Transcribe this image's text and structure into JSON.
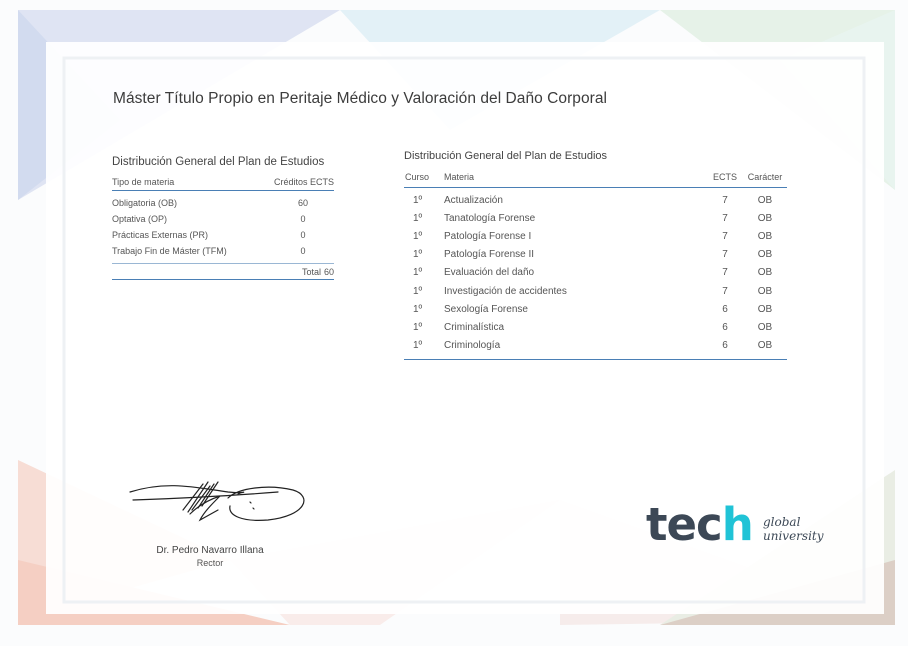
{
  "document": {
    "title": "Máster Título Propio en Peritaje Médico y Valoración del Daño Corporal"
  },
  "summary": {
    "heading": "Distribución General del Plan de Estudios",
    "col_type": "Tipo de materia",
    "col_credits": "Créditos ECTS",
    "rows": [
      {
        "type": "Obligatoria (OB)",
        "credits": "60"
      },
      {
        "type": "Optativa (OP)",
        "credits": "0"
      },
      {
        "type": "Prácticas Externas (PR)",
        "credits": "0"
      },
      {
        "type": "Trabajo Fin de Máster (TFM)",
        "credits": "0"
      }
    ],
    "total_label": "Total",
    "total_value": "60"
  },
  "courses": {
    "heading": "Distribución General del Plan de Estudios",
    "col_course": "Curso",
    "col_subject": "Materia",
    "col_ects": "ECTS",
    "col_type": "Carácter",
    "rows": [
      {
        "course": "1º",
        "subject": "Actualización",
        "ects": "7",
        "type": "OB"
      },
      {
        "course": "1º",
        "subject": "Tanatología Forense",
        "ects": "7",
        "type": "OB"
      },
      {
        "course": "1º",
        "subject": "Patología Forense I",
        "ects": "7",
        "type": "OB"
      },
      {
        "course": "1º",
        "subject": "Patología Forense II",
        "ects": "7",
        "type": "OB"
      },
      {
        "course": "1º",
        "subject": "Evaluación del daño",
        "ects": "7",
        "type": "OB"
      },
      {
        "course": "1º",
        "subject": "Investigación de accidentes",
        "ects": "7",
        "type": "OB"
      },
      {
        "course": "1º",
        "subject": "Sexología Forense",
        "ects": "6",
        "type": "OB"
      },
      {
        "course": "1º",
        "subject": "Criminalística",
        "ects": "6",
        "type": "OB"
      },
      {
        "course": "1º",
        "subject": "Criminología",
        "ects": "6",
        "type": "OB"
      }
    ]
  },
  "signatory": {
    "name": "Dr. Pedro Navarro Illana",
    "role": "Rector"
  },
  "logo": {
    "word_part": "tec",
    "word_accent": "h",
    "tagline_1": "global",
    "tagline_2": "university"
  },
  "colors": {
    "table_rule": "#4a7fb5",
    "logo_dark": "#3c4856",
    "logo_accent": "#20c3d6"
  }
}
